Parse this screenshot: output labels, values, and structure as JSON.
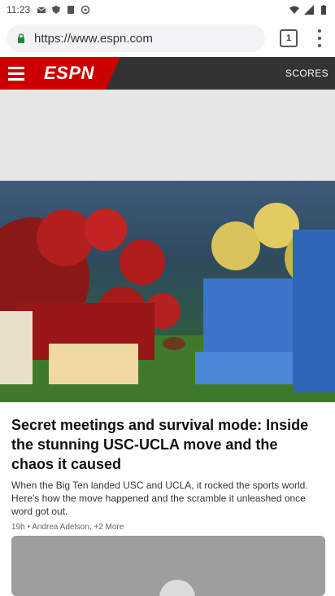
{
  "status_bar": {
    "time": "11:23"
  },
  "browser": {
    "url": "https://www.espn.com",
    "tab_count": "1"
  },
  "espn": {
    "logo_text": "ESPN",
    "scores_label": "SCORES"
  },
  "story": {
    "title": "Secret meetings and survival mode: Inside the stunning USC-UCLA move and the chaos it caused",
    "description": "When the Big Ten landed USC and UCLA, it rocked the sports world. Here's how the move happened and the scramble it unleashed once word got out.",
    "meta": "19h • Andrea Adelson, +2 More"
  },
  "colors": {
    "espn_red": "#cc0000",
    "espn_dark": "#333333"
  }
}
